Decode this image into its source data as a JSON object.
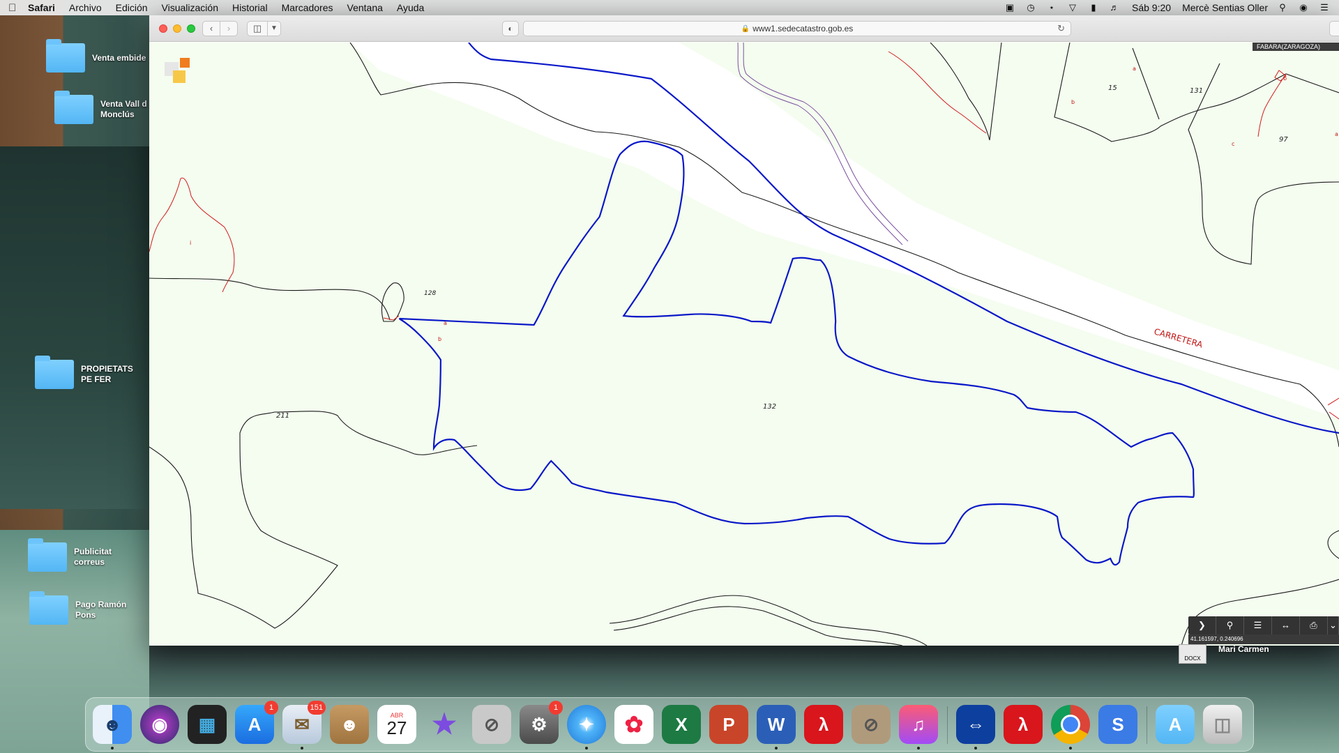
{
  "menubar": {
    "app_name": "Safari",
    "items": [
      "Archivo",
      "Edición",
      "Visualización",
      "Historial",
      "Marcadores",
      "Ventana",
      "Ayuda"
    ],
    "clock": "Sáb 9:20",
    "user": "Mercè Sentias Oller"
  },
  "desktop": {
    "folders": [
      {
        "label": "Venta embide"
      },
      {
        "label": "Venta Vall d Monclús"
      },
      {
        "label": "PROPIETATS PE FER"
      },
      {
        "label": "Publicitat correus"
      },
      {
        "label": "Pago Ramón Pons"
      }
    ],
    "doc_file_ext": "DOCX",
    "doc_file_label": "Mari Carmen"
  },
  "browser": {
    "url": "www1.sedecatastro.gob.es"
  },
  "map": {
    "municipality": "FABARA(ZARAGOZA)",
    "coordinates": "41.161597, 0.240696",
    "parcel_labels": {
      "p132": "132",
      "p131": "131",
      "p15": "15",
      "p97": "97",
      "p211": "211",
      "p128": "128",
      "sub_a1": "a",
      "sub_b1": "b",
      "sub_c": "c",
      "sub_b2": "b",
      "sub_a2": "a",
      "sub_b3": "b",
      "sub_a3": "a",
      "sub_i": "i"
    },
    "road_label": "CARRETERA",
    "colors": {
      "background": "#f4fdef",
      "selected_parcel": "#0a18c8",
      "subparcel": "#d01c1c"
    }
  },
  "dock": {
    "badges": {
      "appstore": "1",
      "mail": "151",
      "calendar_month": "ABR",
      "calendar_day": "27",
      "prefs": "1"
    }
  }
}
